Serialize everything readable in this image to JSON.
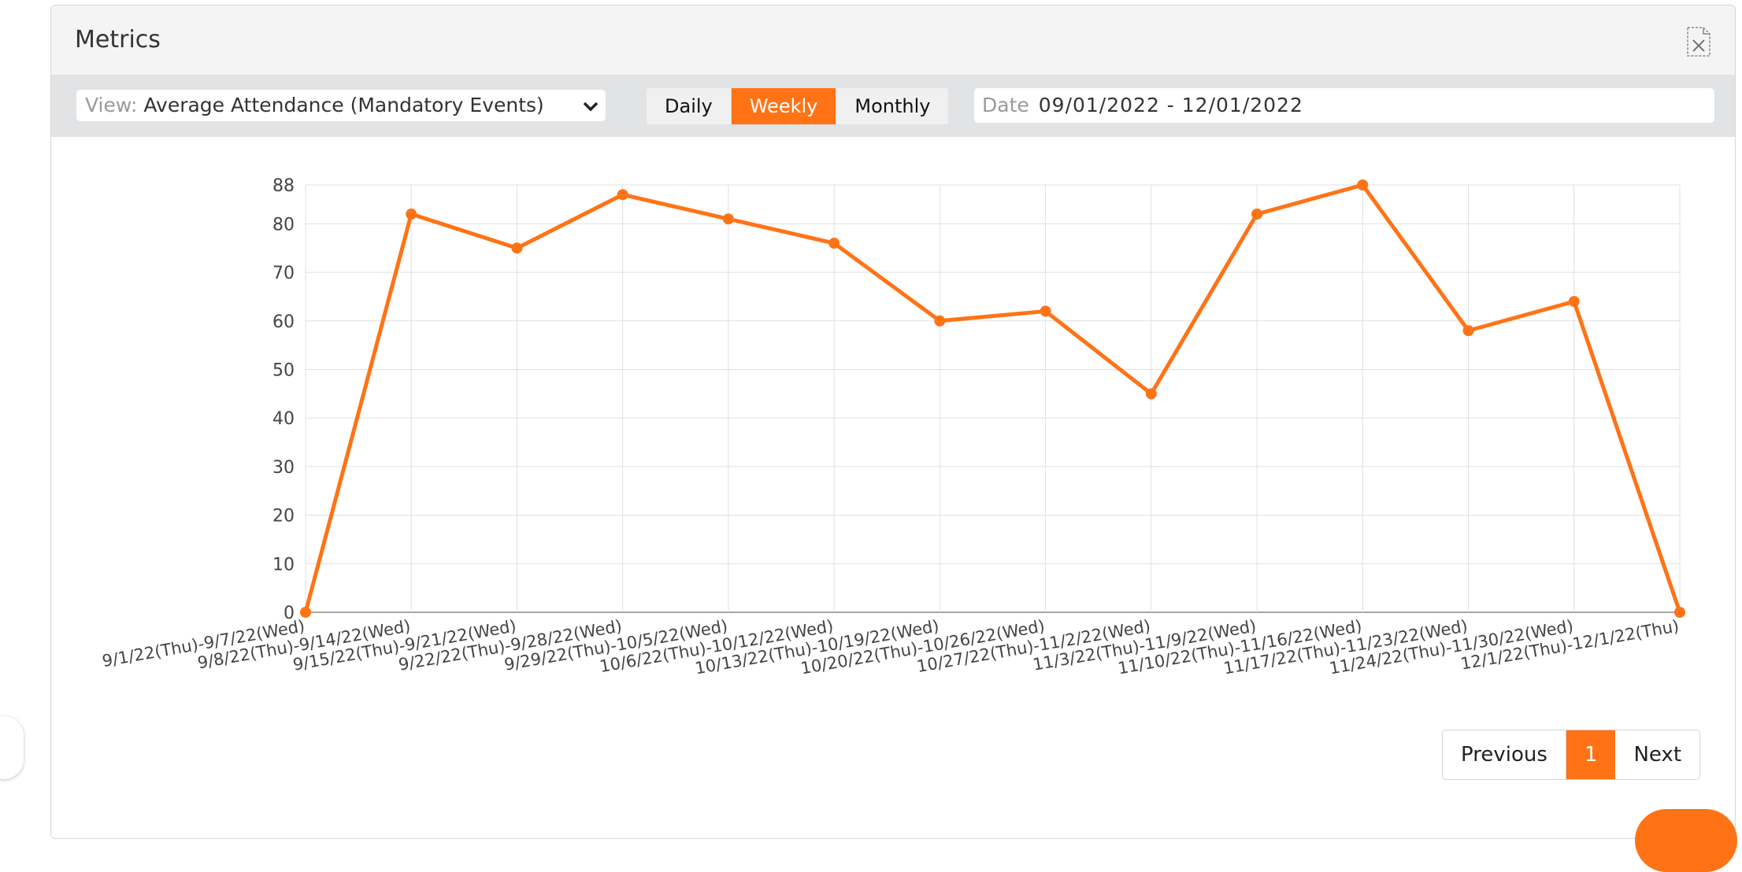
{
  "header": {
    "title": "Metrics",
    "export_icon": "excel-export-icon"
  },
  "toolbar": {
    "view_label": "View:",
    "view_value": "Average Attendance (Mandatory Events)",
    "periods": [
      {
        "label": "Daily",
        "active": false
      },
      {
        "label": "Weekly",
        "active": true
      },
      {
        "label": "Monthly",
        "active": false
      }
    ],
    "date_label": "Date",
    "date_value": "09/01/2022 - 12/01/2022"
  },
  "chart_data": {
    "type": "line",
    "categories": [
      "9/1/22(Thu)-9/7/22(Wed)",
      "9/8/22(Thu)-9/14/22(Wed)",
      "9/15/22(Thu)-9/21/22(Wed)",
      "9/22/22(Thu)-9/28/22(Wed)",
      "9/29/22(Thu)-10/5/22(Wed)",
      "10/6/22(Thu)-10/12/22(Wed)",
      "10/13/22(Thu)-10/19/22(Wed)",
      "10/20/22(Thu)-10/26/22(Wed)",
      "10/27/22(Thu)-11/2/22(Wed)",
      "11/3/22(Thu)-11/9/22(Wed)",
      "11/10/22(Thu)-11/16/22(Wed)",
      "11/17/22(Thu)-11/23/22(Wed)",
      "11/24/22(Thu)-11/30/22(Wed)",
      "12/1/22(Thu)-12/1/22(Thu)"
    ],
    "values": [
      0,
      82,
      75,
      86,
      81,
      76,
      60,
      62,
      45,
      82,
      88,
      58,
      64,
      0
    ],
    "ylim": [
      0,
      88
    ],
    "yticks": [
      0,
      10,
      20,
      30,
      40,
      50,
      60,
      70,
      80,
      88
    ],
    "grid": true,
    "color": "#ff7316"
  },
  "pagination": {
    "previous": "Previous",
    "current": "1",
    "next": "Next"
  },
  "colors": {
    "accent": "#ff7316"
  }
}
